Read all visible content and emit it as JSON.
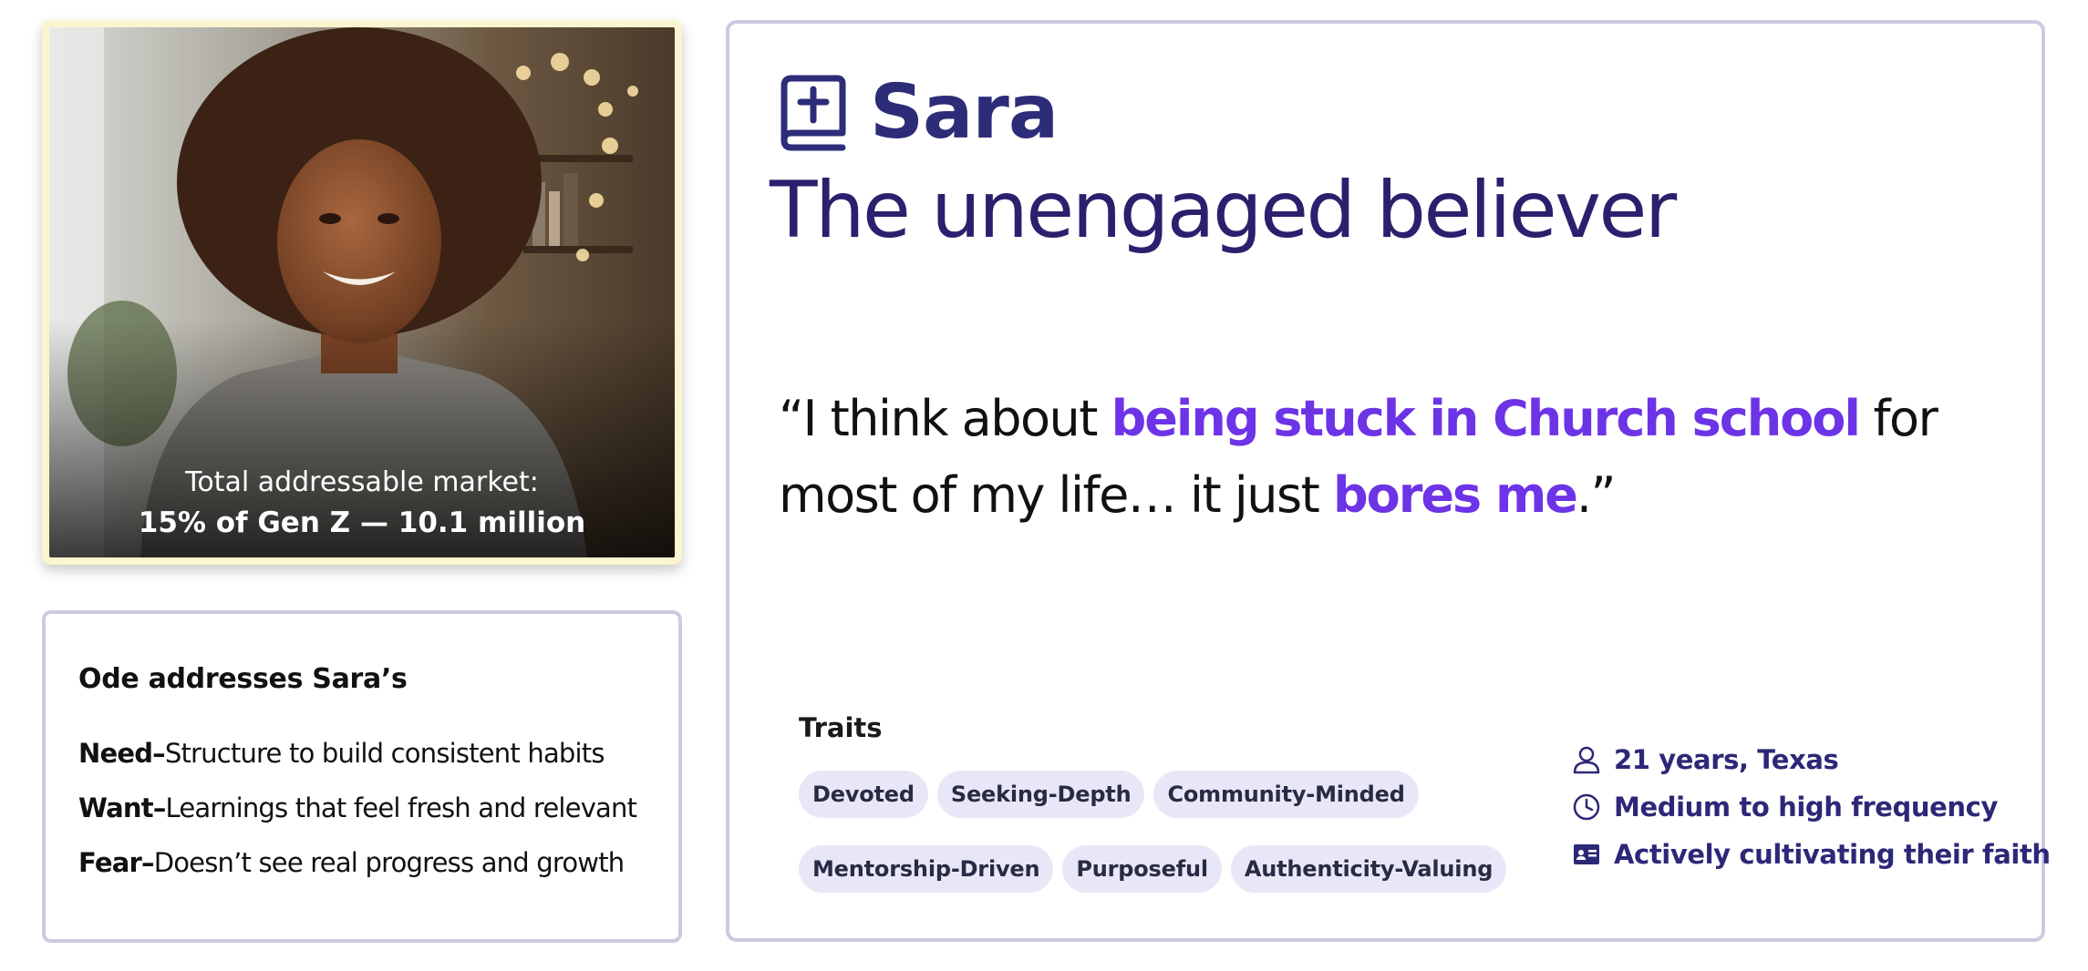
{
  "photo": {
    "alt": "Portrait of smiling woman with curly hair",
    "tam_label": "Total addressable market:",
    "tam_value": "15% of Gen Z — 10.1 million"
  },
  "ode": {
    "title": "Ode addresses Sara’s",
    "need_label": "Need–",
    "need_text": "Structure to build consistent habits",
    "want_label": "Want–",
    "want_text": "Learnings that feel fresh and relevant",
    "fear_label": "Fear–",
    "fear_text": "Doesn’t see real progress and growth"
  },
  "persona": {
    "icon": "bible-icon",
    "name": "Sara",
    "archetype": "The unengaged believer",
    "quote": {
      "part1": "“I think about ",
      "highlight1": "being stuck in Church school",
      "part2": " for most of my life… it just ",
      "highlight2": "bores me",
      "part3": ".”"
    }
  },
  "traits": {
    "title": "Traits",
    "items": [
      "Devoted",
      "Seeking-Depth",
      "Community-Minded",
      "Mentorship-Driven",
      "Purposeful",
      "Authenticity-Valuing"
    ]
  },
  "facts": [
    {
      "icon": "person-icon",
      "text": "21 years, Texas"
    },
    {
      "icon": "clock-icon",
      "text": "Medium to high frequency"
    },
    {
      "icon": "id-card-icon",
      "text": "Actively cultivating their faith"
    }
  ],
  "colors": {
    "name": "#2c2c78",
    "highlight": "#6d33e6",
    "chip_bg": "#e8e7f7",
    "card_border": "#cccae0",
    "photo_frame": "#fbf5cf"
  }
}
